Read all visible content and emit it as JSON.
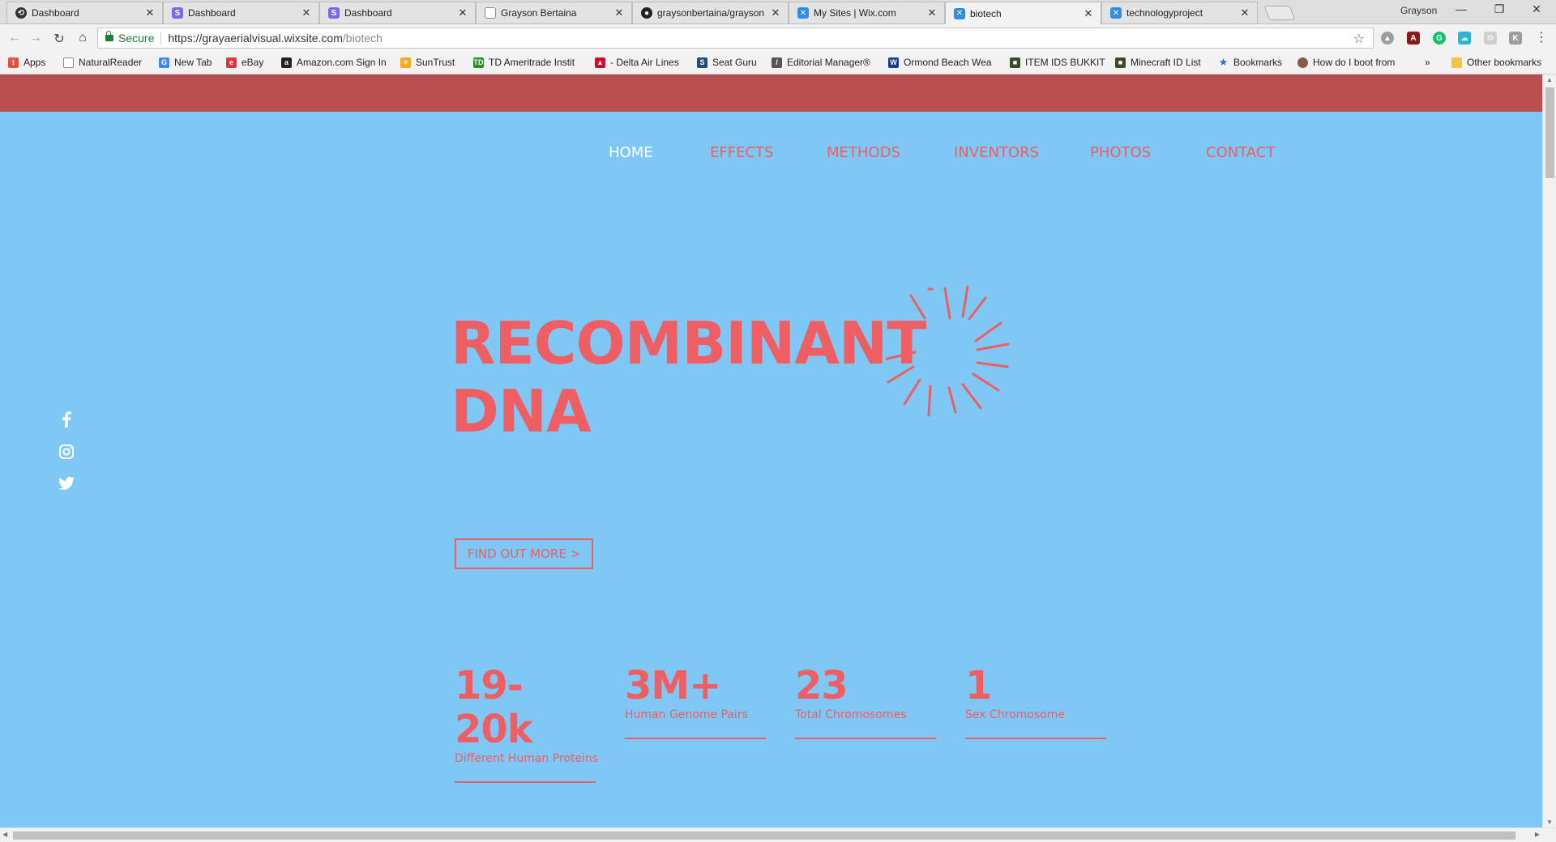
{
  "browser": {
    "tabs": [
      {
        "title": "Dashboard",
        "icon": "squarespace-icon",
        "color": "#333333"
      },
      {
        "title": "Dashboard",
        "icon": "s-logo-icon",
        "color": "#7b68ee"
      },
      {
        "title": "Dashboard",
        "icon": "s-logo-icon",
        "color": "#7b68ee"
      },
      {
        "title": "Grayson Bertaina",
        "icon": "page-icon",
        "color": "#888888"
      },
      {
        "title": "graysonbertaina/grayson",
        "icon": "github-icon",
        "color": "#222222"
      },
      {
        "title": "My Sites | Wix.com",
        "icon": "wix-icon",
        "color": "#2f8ee0"
      },
      {
        "title": "biotech",
        "icon": "wix-icon",
        "color": "#2f8ee0"
      },
      {
        "title": "technologyproject",
        "icon": "wix-icon",
        "color": "#2f8ee0"
      }
    ],
    "profile_name": "Grayson",
    "address": {
      "secure_label": "Secure",
      "url_host": "https://grayaerialvisual.wixsite.com",
      "url_path": "/biotech"
    },
    "bookmarks": [
      {
        "label": "Apps",
        "icon": "apps-grid-icon",
        "color": "#e0533f"
      },
      {
        "label": "NaturalReader",
        "icon": "page-icon",
        "color": "#888888"
      },
      {
        "label": "New Tab",
        "icon": "google-icon",
        "color": "#4285f4"
      },
      {
        "label": "eBay",
        "icon": "ebay-icon",
        "color": "#e53238"
      },
      {
        "label": "Amazon.com Sign In",
        "icon": "amazon-icon",
        "color": "#222222"
      },
      {
        "label": "SunTrust",
        "icon": "suntrust-icon",
        "color": "#f7a823"
      },
      {
        "label": "TD Ameritrade Instit",
        "icon": "td-icon",
        "color": "#2e8b2e"
      },
      {
        "label": "- Delta Air Lines",
        "icon": "delta-icon",
        "color": "#c8102e"
      },
      {
        "label": "Seat Guru",
        "icon": "seatguru-icon",
        "color": "#1f4e79"
      },
      {
        "label": "Editorial Manager®",
        "icon": "editorial-icon",
        "color": "#555555"
      },
      {
        "label": "Ormond Beach Wea",
        "icon": "weather-icon",
        "color": "#1a3c8c"
      },
      {
        "label": "ITEM IDS BUKKIT",
        "icon": "minecraft-icon",
        "color": "#3b4a2a"
      },
      {
        "label": "Minecraft ID List",
        "icon": "minecraft-icon",
        "color": "#3b4a2a"
      },
      {
        "label": "Bookmarks",
        "icon": "star-icon",
        "color": "#2a6ee0"
      },
      {
        "label": "How do I boot from",
        "icon": "avatar-icon",
        "color": "#8a5a44"
      }
    ],
    "bookmarks_overflow": "»",
    "other_bookmarks": "Other bookmarks"
  },
  "site": {
    "nav": [
      {
        "label": "HOME",
        "current": true
      },
      {
        "label": "EFFECTS",
        "current": false
      },
      {
        "label": "METHODS",
        "current": false
      },
      {
        "label": "INVENTORS",
        "current": false
      },
      {
        "label": "PHOTOS",
        "current": false
      },
      {
        "label": "CONTACT",
        "current": false
      }
    ],
    "social": [
      {
        "icon": "facebook-icon"
      },
      {
        "icon": "instagram-icon"
      },
      {
        "icon": "twitter-icon"
      }
    ],
    "hero": {
      "line1": "RECOMBINANT",
      "line2": "DNA",
      "cta": "FIND OUT MORE >"
    },
    "stats": [
      {
        "value": "19-20k",
        "label": "Different Human Proteins"
      },
      {
        "value": "3M+",
        "label": "Human Genome Pairs"
      },
      {
        "value": "23",
        "label": "Total Chromosomes"
      },
      {
        "value": "1",
        "label": "Sex Chromosome"
      }
    ],
    "colors": {
      "background": "#7fc8f5",
      "band": "#b94f4f",
      "accent": "#ee5e63",
      "nav_current": "#ffffff"
    }
  }
}
